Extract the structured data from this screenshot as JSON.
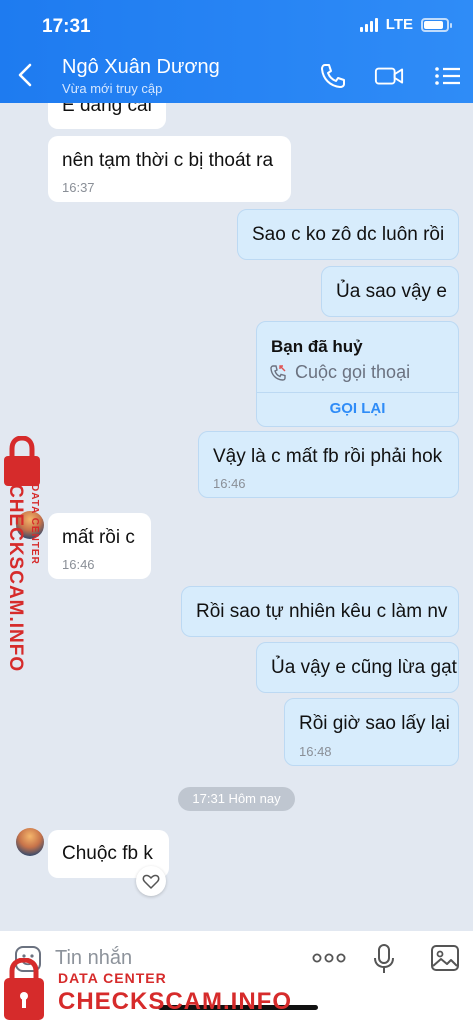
{
  "status_bar": {
    "time": "17:31",
    "network": "LTE",
    "battery_level": 0.85
  },
  "header": {
    "contact_name": "Ngô Xuân Dương",
    "contact_status": "Vừa mới truy cập"
  },
  "messages": [
    {
      "direction": "in",
      "text": "E đang cài",
      "time": ""
    },
    {
      "direction": "in",
      "text": "nên tạm thời c bị thoát ra",
      "time": "16:37"
    },
    {
      "direction": "out",
      "text": "Sao c ko zô dc luôn rồi",
      "time": ""
    },
    {
      "direction": "out",
      "text": "Ủa sao vậy e",
      "time": ""
    },
    {
      "direction": "out",
      "text": "Vậy là c mất fb rồi phải hok",
      "time": "16:46"
    },
    {
      "direction": "in",
      "text": "mất rồi c",
      "time": "16:46"
    },
    {
      "direction": "out",
      "text": "Rồi sao tự nhiên kêu c làm nv",
      "time": ""
    },
    {
      "direction": "out",
      "text": "Ủa vậy e cũng lừa gạt",
      "time": ""
    },
    {
      "direction": "out",
      "text": "Rồi giờ sao lấy lại",
      "time": "16:48"
    },
    {
      "direction": "in",
      "text": "Chuộc fb k",
      "time": ""
    }
  ],
  "call_card": {
    "title": "Bạn đã huỷ",
    "subtitle": "Cuộc gọi thoại",
    "action": "GỌI LẠI"
  },
  "date_separator": "17:31 Hôm nay",
  "input": {
    "placeholder": "Tin nhắn"
  },
  "watermark": {
    "line1": "DATA CENTER",
    "line2": "CHECKSCAM.INFO"
  },
  "colors": {
    "header": "#2f8cf7",
    "outgoing_bubble": "#d7ecfc",
    "incoming_bubble": "#ffffff",
    "chat_background": "#e2e8f1",
    "watermark": "#d62b2b"
  }
}
